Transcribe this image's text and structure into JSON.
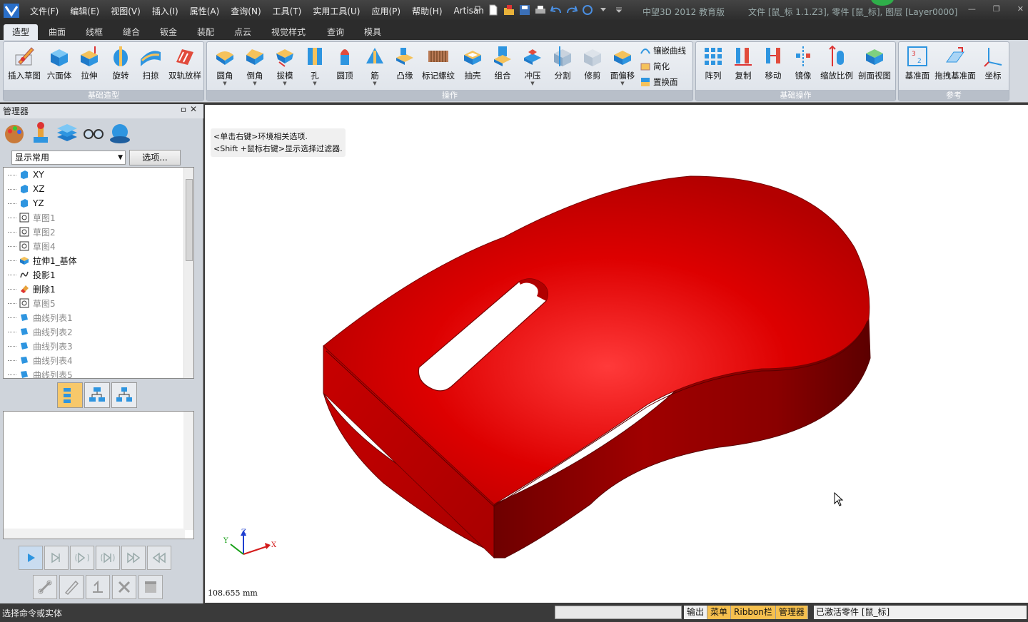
{
  "menu": [
    "文件(F)",
    "编辑(E)",
    "视图(V)",
    "插入(I)",
    "属性(A)",
    "查询(N)",
    "工具(T)",
    "实用工具(U)",
    "应用(P)",
    "帮助(H)",
    "Artisan"
  ],
  "window": {
    "app_title": "中望3D 2012 教育版",
    "doc_title": "文件 [鼠_标 1.1.Z3], 零件 [鼠_标], 图层 [Layer0000]"
  },
  "tabs": [
    "造型",
    "曲面",
    "线框",
    "缝合",
    "钣金",
    "装配",
    "点云",
    "视觉样式",
    "查询",
    "模具"
  ],
  "ribbon": {
    "groups": {
      "basic_modeling": "基础造型",
      "operations": "操作",
      "basic_ops": "基础操作",
      "reference": "参考"
    },
    "basic_modeling": [
      "插入草图",
      "六面体",
      "拉伸",
      "旋转",
      "扫掠",
      "双轨放样"
    ],
    "operations": [
      "圆角",
      "倒角",
      "拔模",
      "孔",
      "圆顶",
      "筋",
      "凸缘",
      "标记螺纹",
      "抽壳",
      "组合",
      "冲压",
      "分割",
      "修剪",
      "面偏移"
    ],
    "operations_small": [
      "镶嵌曲线",
      "简化",
      "置换面"
    ],
    "basic_ops": [
      "阵列",
      "复制",
      "移动",
      "镜像",
      "缩放比例",
      "剖面视图"
    ],
    "reference": [
      "基准面",
      "拖拽基准面",
      "坐标"
    ]
  },
  "manager": {
    "title": "管理器",
    "pin": "ㅁ",
    "close": "✕",
    "filter": "显示常用",
    "options_button": "选项...",
    "tree": [
      {
        "label": "XY",
        "icon": "plane-icon",
        "dim": false
      },
      {
        "label": "XZ",
        "icon": "plane-icon",
        "dim": false
      },
      {
        "label": "YZ",
        "icon": "plane-icon",
        "dim": false
      },
      {
        "label": "草图1",
        "icon": "sketch-icon",
        "dim": true
      },
      {
        "label": "草图2",
        "icon": "sketch-icon",
        "dim": true
      },
      {
        "label": "草图4",
        "icon": "sketch-icon",
        "dim": true
      },
      {
        "label": "拉伸1_基体",
        "icon": "extrude-icon",
        "dim": false
      },
      {
        "label": "投影1",
        "icon": "curve-icon",
        "dim": false
      },
      {
        "label": "删除1",
        "icon": "eraser-icon",
        "dim": false
      },
      {
        "label": "草图5",
        "icon": "sketch-icon",
        "dim": true
      },
      {
        "label": "曲线列表1",
        "icon": "curvelist-icon",
        "dim": true
      },
      {
        "label": "曲线列表2",
        "icon": "curvelist-icon",
        "dim": true
      },
      {
        "label": "曲线列表3",
        "icon": "curvelist-icon",
        "dim": true
      },
      {
        "label": "曲线列表4",
        "icon": "curvelist-icon",
        "dim": true
      },
      {
        "label": "曲线列表5",
        "icon": "curvelist-icon",
        "dim": true
      }
    ]
  },
  "viewport": {
    "hint_line1": "<单击右键>环境相关选项.",
    "hint_line2": "<Shift +鼠标右键>显示选择过滤器.",
    "scale": "108.655 mm",
    "axis_x": "X",
    "axis_y": "Y",
    "axis_z": "Z"
  },
  "status": {
    "prompt": "选择命令或实体",
    "tabs": [
      "输出",
      "菜单",
      "Ribbon栏",
      "管理器"
    ],
    "active_part": "已激活零件 [鼠_标]"
  },
  "colors": {
    "model_red": "#d40000",
    "accent_orange": "#f6c04e"
  }
}
